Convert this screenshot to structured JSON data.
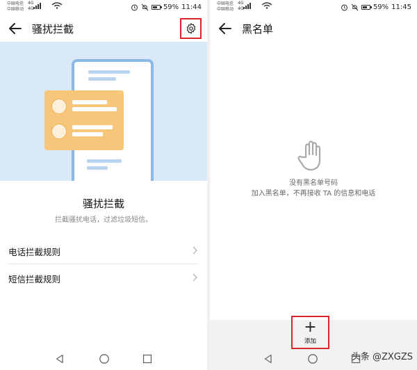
{
  "left": {
    "status": {
      "carrier_1": "中国电信",
      "carrier_2": "中国移动",
      "net_1": "4G",
      "net_2": "4G",
      "battery": "59%",
      "time": "11:44"
    },
    "header": {
      "title": "骚扰拦截"
    },
    "hero": {
      "title": "骚扰拦截",
      "subtitle": "拦截骚扰电话，过滤垃圾短信。"
    },
    "list": [
      {
        "label": "电话拦截规则"
      },
      {
        "label": "短信拦截规则"
      }
    ]
  },
  "right": {
    "status": {
      "carrier_1": "中国电信",
      "carrier_2": "中国移动",
      "net_1": "4G",
      "net_2": "4G",
      "battery": "59%",
      "time": "11:45"
    },
    "header": {
      "title": "黑名单"
    },
    "empty": {
      "title": "没有黑名单号码",
      "subtitle": "加入黑名单，不再接收 TA 的信息和电话"
    },
    "bottom": {
      "add_label": "添加"
    }
  },
  "watermark": "头条 @ZXGZS",
  "colors": {
    "highlight": "#d7262c",
    "hero_bg": "#d9e9f8",
    "card": "#f8c67a",
    "phone_border": "#8db8e6"
  },
  "icons": [
    "back-arrow-icon",
    "gear-icon",
    "chevron-right-icon",
    "hand-stop-icon",
    "plus-icon",
    "nav-back-icon",
    "nav-home-icon",
    "nav-recent-icon",
    "alarm-icon",
    "mute-icon",
    "wifi-icon",
    "battery-icon"
  ]
}
